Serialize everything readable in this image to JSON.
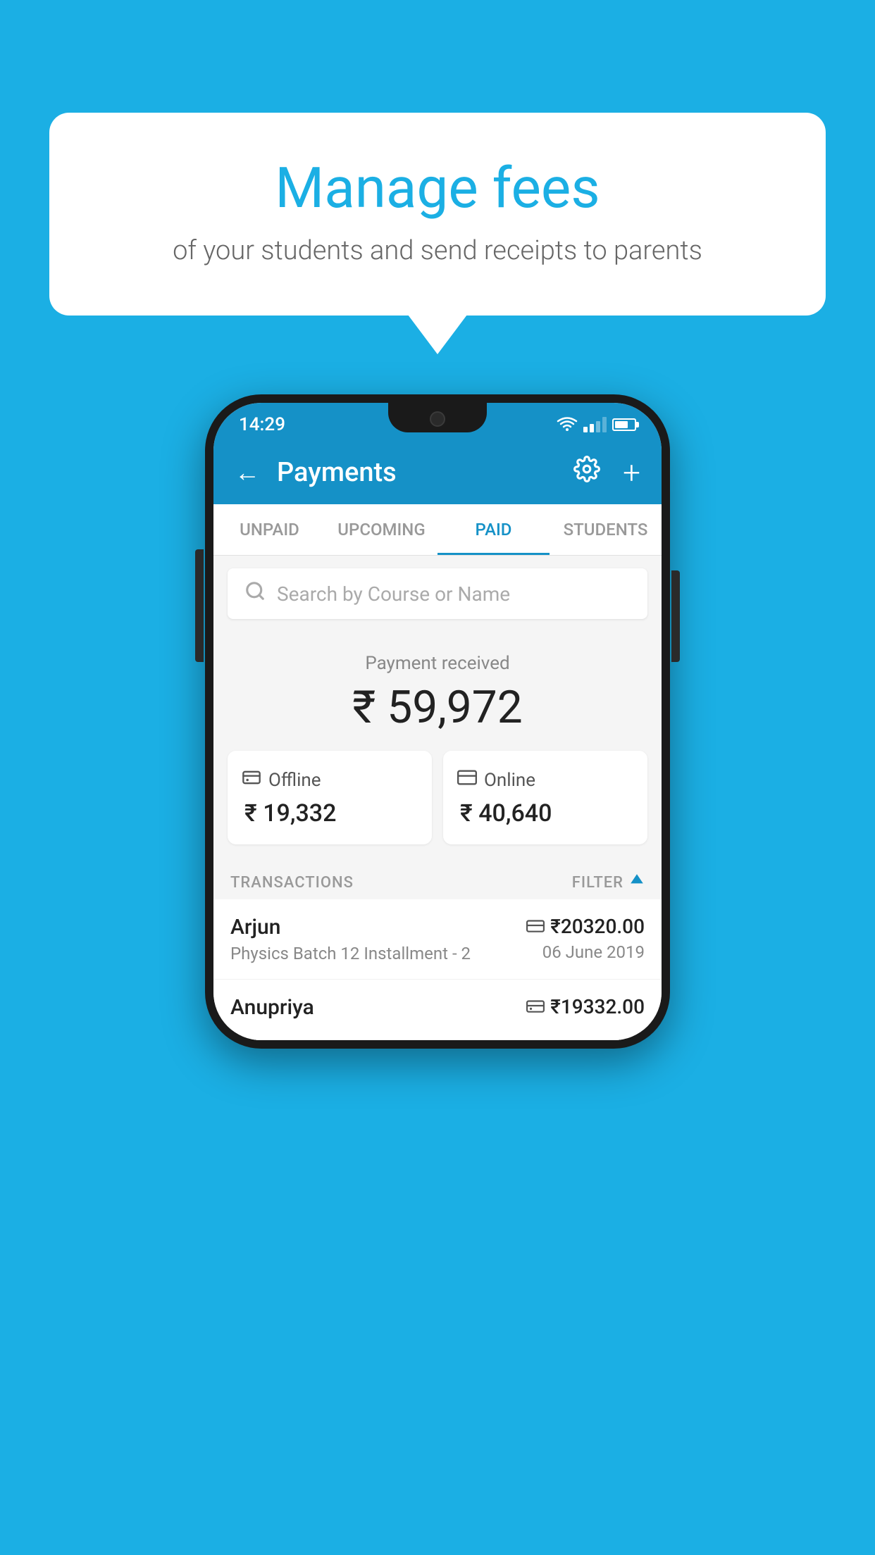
{
  "background_color": "#1BAFE4",
  "speech_bubble": {
    "title": "Manage fees",
    "subtitle": "of your students and send receipts to parents"
  },
  "status_bar": {
    "time": "14:29"
  },
  "app_header": {
    "title": "Payments",
    "back_label": "←",
    "plus_label": "+"
  },
  "tabs": [
    {
      "label": "UNPAID",
      "active": false
    },
    {
      "label": "UPCOMING",
      "active": false
    },
    {
      "label": "PAID",
      "active": true
    },
    {
      "label": "STUDENTS",
      "active": false
    }
  ],
  "search": {
    "placeholder": "Search by Course or Name"
  },
  "payment_received": {
    "label": "Payment received",
    "amount": "₹ 59,972",
    "cards": [
      {
        "label": "Offline",
        "amount": "₹ 19,332"
      },
      {
        "label": "Online",
        "amount": "₹ 40,640"
      }
    ]
  },
  "transactions": {
    "section_label": "TRANSACTIONS",
    "filter_label": "FILTER",
    "rows": [
      {
        "name": "Arjun",
        "course": "Physics Batch 12 Installment - 2",
        "amount": "₹20320.00",
        "date": "06 June 2019",
        "payment_type": "online"
      },
      {
        "name": "Anupriya",
        "course": "",
        "amount": "₹19332.00",
        "date": "",
        "payment_type": "offline"
      }
    ]
  }
}
